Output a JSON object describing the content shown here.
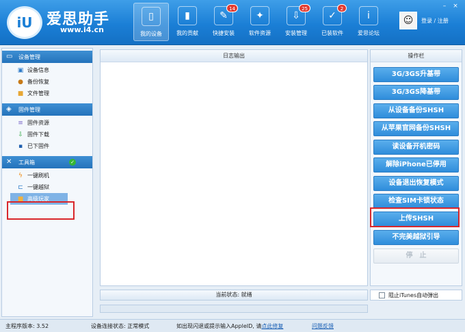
{
  "header": {
    "brand": "爱思助手",
    "url": "www.i4.cn",
    "logo_text": "iU",
    "nav": [
      {
        "label": "我的设备",
        "icon": "phone-icon",
        "badge": null
      },
      {
        "label": "我的贡献",
        "icon": "chart-icon",
        "badge": null
      },
      {
        "label": "快捷安装",
        "icon": "install-icon",
        "badge": "14"
      },
      {
        "label": "软件资源",
        "icon": "apps-icon",
        "badge": null
      },
      {
        "label": "安装管理",
        "icon": "download-icon",
        "badge": "25"
      },
      {
        "label": "已装软件",
        "icon": "check-icon",
        "badge": "2"
      },
      {
        "label": "爱思论坛",
        "icon": "forum-icon",
        "badge": null
      }
    ],
    "user_text": "登录 / 注册"
  },
  "sidebar": {
    "groups": [
      {
        "title": "设备管理",
        "items": [
          "设备信息",
          "备份恢复",
          "文件管理"
        ]
      },
      {
        "title": "固件管理",
        "items": [
          "固件资源",
          "固件下载",
          "已下固件"
        ]
      },
      {
        "title": "工具箱",
        "items": [
          "一键刷机",
          "一键越狱",
          "高级玩家"
        ]
      }
    ]
  },
  "log": {
    "title": "日志输出"
  },
  "status": {
    "text": "当前状态: 就绪"
  },
  "ops": {
    "title": "操作栏",
    "buttons": [
      "3G/3GS升基带",
      "3G/3GS降基带",
      "从设备备份SHSH",
      "从苹果官网备份SHSH",
      "读设备开机密码",
      "解除iPhone已停用",
      "设备退出恢复模式",
      "检查SIM卡锁状态",
      "上传SHSH",
      "不完美越狱引导",
      "停　止"
    ],
    "itunes_label": "阻止iTunes自动弹出"
  },
  "footer": {
    "version": "主程序版本: 3.52",
    "connection": "设备连接状态: 正常模式",
    "tip_prefix": "如出现闪退或提示输入AppleID, 请",
    "tip_link": "点此修复",
    "feedback": "问题反馈"
  }
}
